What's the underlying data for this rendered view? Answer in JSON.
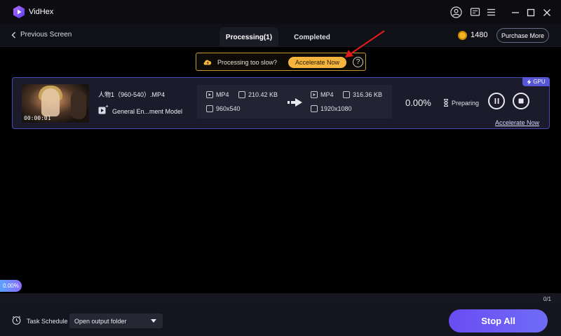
{
  "app": {
    "title": "VidHex"
  },
  "nav": {
    "back_label": "Previous Screen",
    "tabs": [
      {
        "label": "Processing(1)",
        "active": true
      },
      {
        "label": "Completed",
        "active": false
      }
    ],
    "credits": "1480",
    "purchase_label": "Purchase More"
  },
  "notice": {
    "text": "Processing too slow?",
    "button_label": "Accelerate Now",
    "help_label": "?"
  },
  "task": {
    "badge": "GPU",
    "thumbnail_time": "00:00:01",
    "filename": "人物1（960-540）.MP4",
    "model": "General En...ment Model",
    "source": {
      "format": "MP4",
      "size": "210.42 KB",
      "resolution": "960x540"
    },
    "output": {
      "format": "MP4",
      "size": "316.36 KB",
      "resolution": "1920x1080"
    },
    "percent": "0.00%",
    "status": "Preparing",
    "accelerate_link": "Accelerate Now"
  },
  "progress": {
    "overall": "0.00%",
    "count": "0/1"
  },
  "footer": {
    "task_schedule_label": "Task Schedule",
    "schedule_option": "Open output folder",
    "stop_all_label": "Stop All"
  },
  "colors": {
    "accent": "#6a4cf3",
    "warning": "#f4b43d",
    "card_border": "#4a4aaf",
    "annotation": "#e01b1b"
  }
}
